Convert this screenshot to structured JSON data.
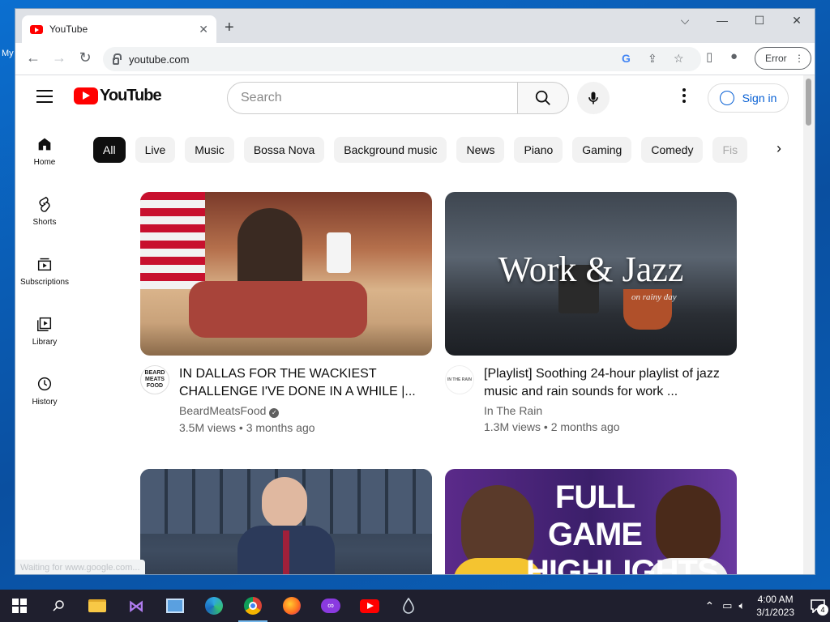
{
  "desktop": {
    "label": "My"
  },
  "browser": {
    "tab_title": "YouTube",
    "url": "youtube.com",
    "error_label": "Error",
    "status": "Waiting for www.google.com..."
  },
  "youtube": {
    "logo_text": "YouTube",
    "search_placeholder": "Search",
    "sign_in": "Sign in",
    "guide": [
      {
        "label": "Home",
        "icon": "home-icon"
      },
      {
        "label": "Shorts",
        "icon": "shorts-icon"
      },
      {
        "label": "Subscriptions",
        "icon": "subscriptions-icon"
      },
      {
        "label": "Library",
        "icon": "library-icon"
      },
      {
        "label": "History",
        "icon": "history-icon"
      }
    ],
    "chips": [
      "All",
      "Live",
      "Music",
      "Bossa Nova",
      "Background music",
      "News",
      "Piano",
      "Gaming",
      "Comedy",
      "Fis"
    ],
    "videos": [
      {
        "title": "IN DALLAS FOR THE WACKIEST CHALLENGE I'VE DONE IN A WHILE |...",
        "channel": "BeardMeatsFood",
        "verified": true,
        "stats": "3.5M views • 3 months ago",
        "avatar_text": "BEARD MEATS FOOD"
      },
      {
        "title": "[Playlist] Soothing 24-hour playlist of jazz music and rain sounds for work ...",
        "channel": "In The Rain",
        "verified": false,
        "stats": "1.3M views • 2 months ago",
        "thumb_text": "Work & Jazz",
        "thumb_subtext": "on rainy day",
        "avatar_text": "IN THE RAIN"
      },
      {
        "title": "",
        "channel": "",
        "stats": ""
      },
      {
        "title": "",
        "channel": "",
        "stats": "",
        "thumb_text": "FULL GAME HIGHLIGHTS"
      }
    ]
  },
  "taskbar": {
    "time": "4:00 AM",
    "date": "3/1/2023",
    "notification_count": "4",
    "apps": [
      "start-icon",
      "search-icon",
      "file-explorer-icon",
      "visual-studio-icon",
      "control-panel-icon",
      "edge-icon",
      "chrome-icon",
      "firefox-icon",
      "app-icon",
      "youtube-app-icon",
      "droplet-icon"
    ]
  },
  "colors": {
    "yt_red": "#ff0000",
    "link_blue": "#065fd4",
    "taskbar": "#1f1f2e"
  }
}
